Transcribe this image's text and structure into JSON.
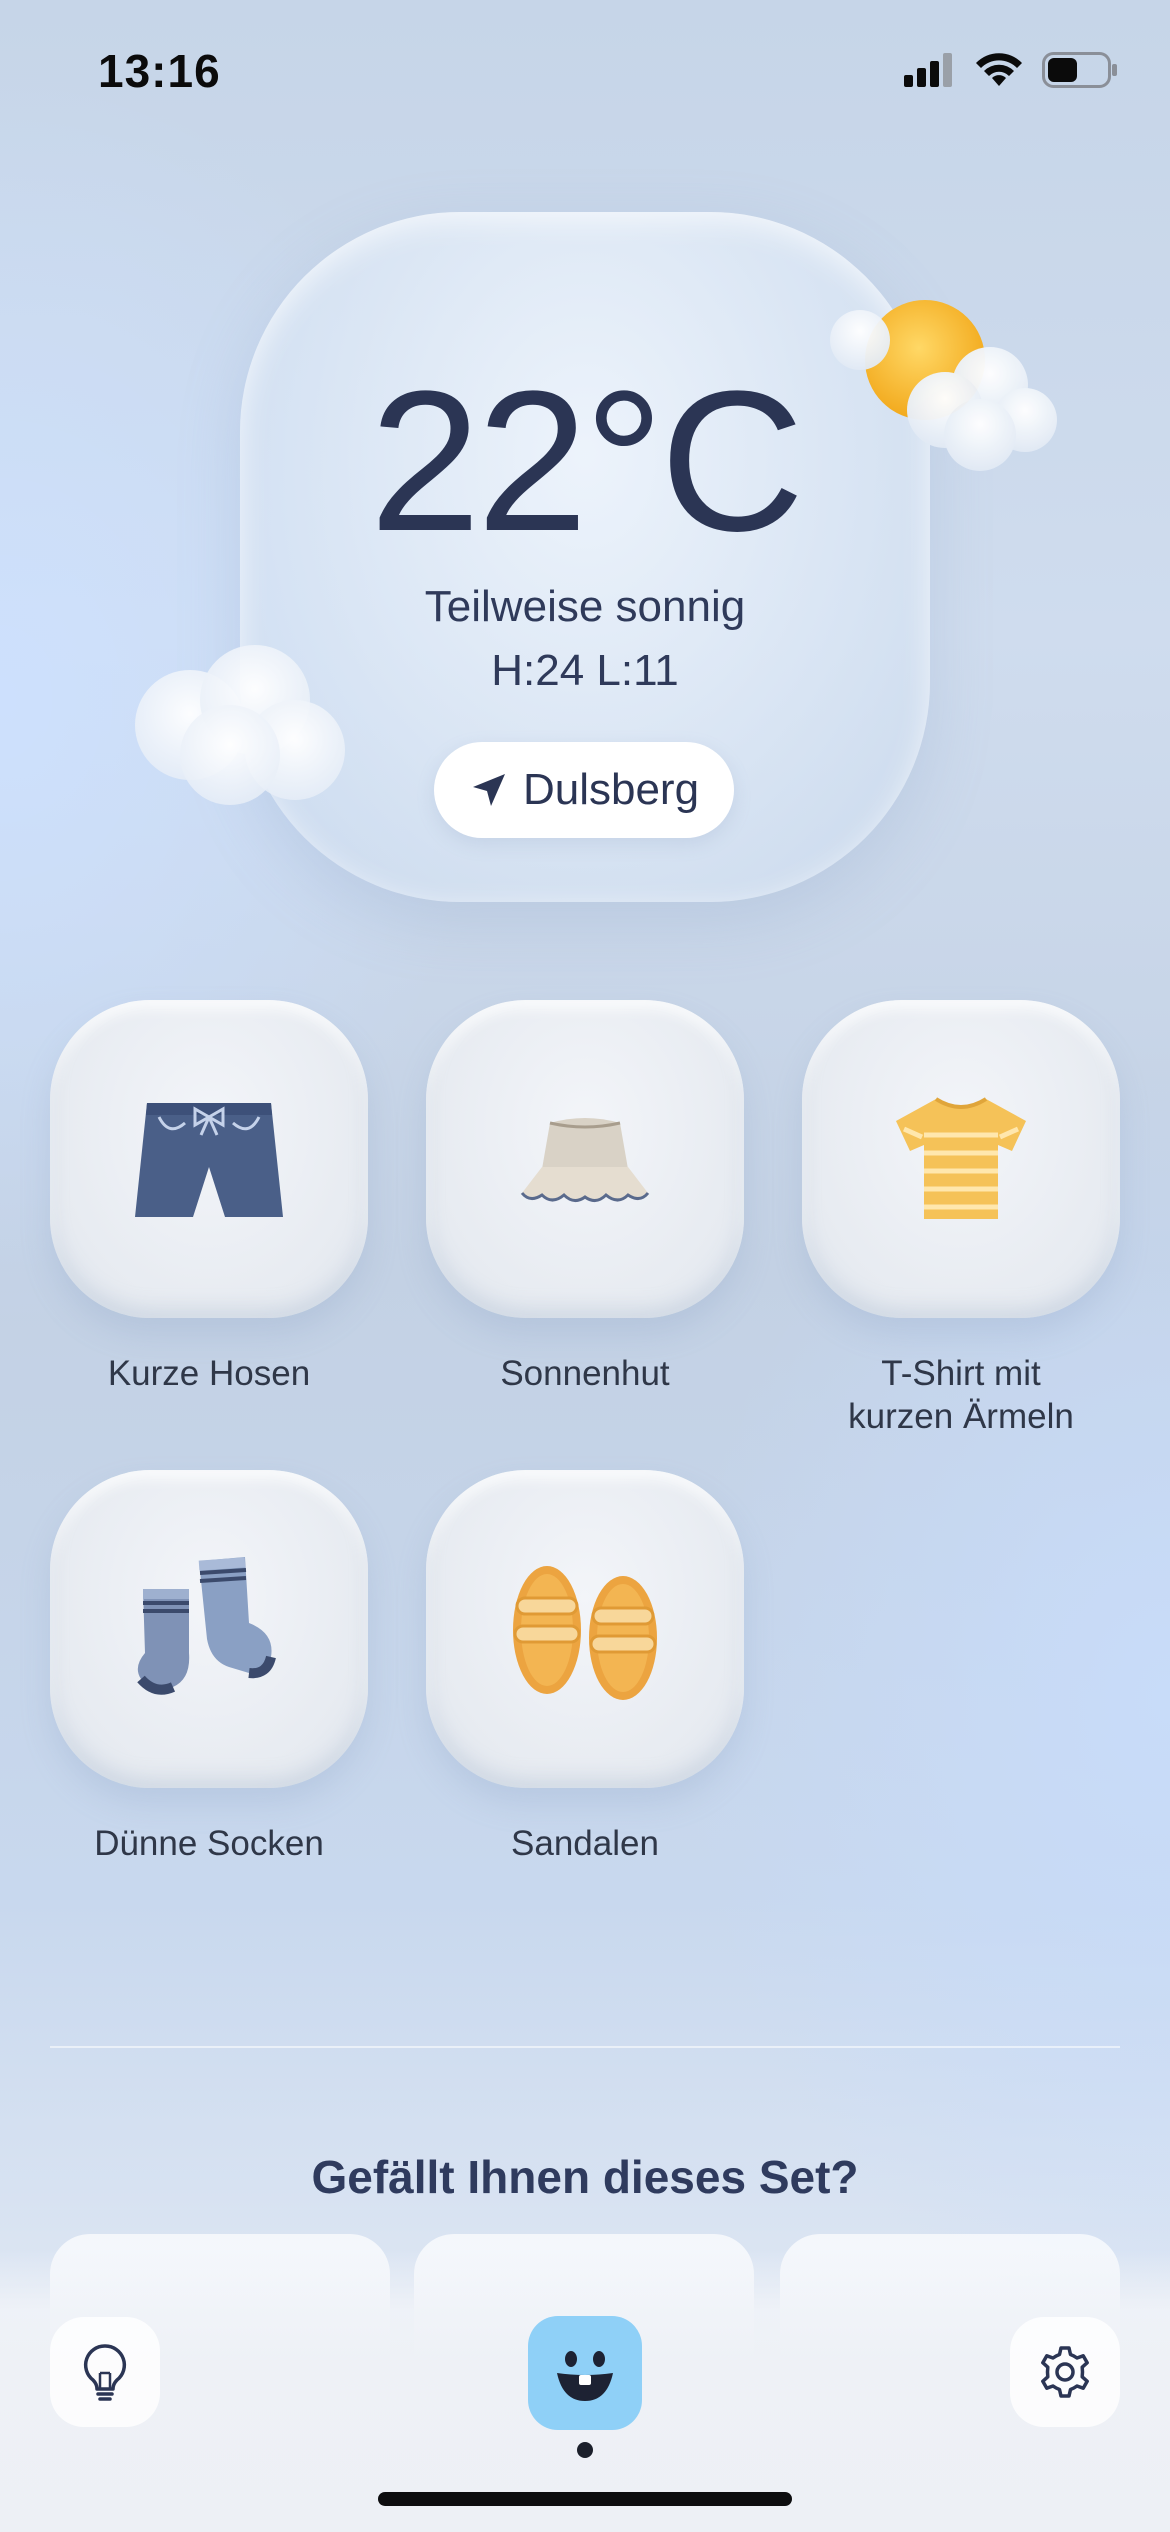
{
  "status_bar": {
    "time": "13:16",
    "icons": [
      "cellular-signal-icon",
      "wifi-icon",
      "battery-icon"
    ],
    "battery_level": 0.5
  },
  "weather": {
    "temperature": "22°C",
    "condition": "Teilweise sonnig",
    "high_low": "H:24 L:11",
    "location": "Dulsberg",
    "location_icon": "location-arrow-icon",
    "weather_icon": "partly-sunny-icon"
  },
  "clothing": [
    {
      "label": "Kurze Hosen",
      "icon": "shorts-icon"
    },
    {
      "label": "Sonnenhut",
      "icon": "sun-hat-icon"
    },
    {
      "label": "T-Shirt mit kurzen Ärmeln",
      "icon": "t-shirt-icon"
    },
    {
      "label": "Dünne Socken",
      "icon": "socks-icon"
    },
    {
      "label": "Sandalen",
      "icon": "sandals-icon"
    }
  ],
  "feedback": {
    "title": "Gefällt Ihnen dieses Set?"
  },
  "nav": {
    "left_icon": "lightbulb-icon",
    "center_icon": "smiley-mascot-icon",
    "right_icon": "gear-icon"
  },
  "colors": {
    "text_primary": "#2b3554",
    "mascot": "#8fd0f7",
    "sun": "#f6b92b",
    "shorts": "#4a5f88",
    "sandals": "#eca440"
  }
}
